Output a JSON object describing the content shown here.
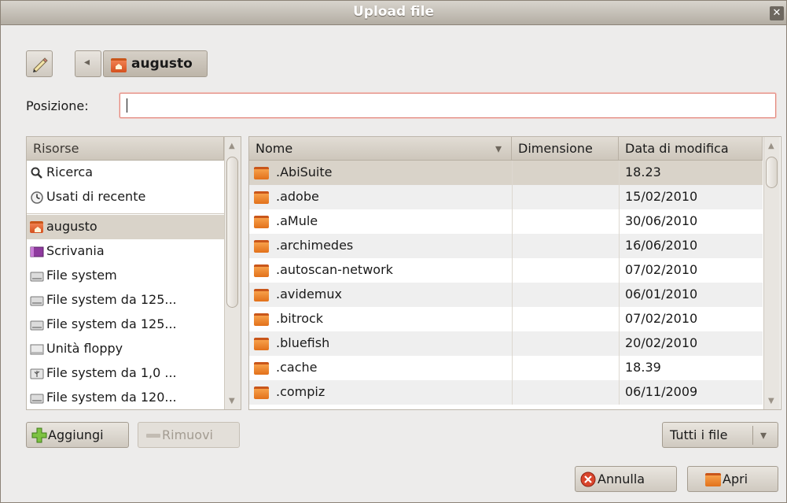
{
  "window": {
    "title": "Upload file",
    "close_glyph": "✕"
  },
  "toolbar": {
    "crumb_label": "augusto",
    "back_glyph": "◂"
  },
  "location": {
    "label": "Posizione:",
    "value": ""
  },
  "places": {
    "header": "Risorse",
    "items": [
      {
        "label": "Ricerca",
        "icon": "search-icon"
      },
      {
        "label": "Usati di recente",
        "icon": "recent-icon"
      },
      {
        "label": "augusto",
        "icon": "home-folder-icon"
      },
      {
        "label": "Scrivania",
        "icon": "desktop-icon"
      },
      {
        "label": "File system",
        "icon": "drive-icon"
      },
      {
        "label": "File system da 125...",
        "icon": "drive-icon"
      },
      {
        "label": "File system da 125...",
        "icon": "drive-icon"
      },
      {
        "label": "Unità floppy",
        "icon": "floppy-icon"
      },
      {
        "label": "File system da 1,0 ...",
        "icon": "usb-drive-icon"
      },
      {
        "label": "File system da 120...",
        "icon": "drive-icon"
      }
    ]
  },
  "files": {
    "columns": [
      "Nome",
      "Dimensione",
      "Data di modifica"
    ],
    "sort_glyph": "▾",
    "rows": [
      {
        "name": ".AbiSuite",
        "size": "",
        "date": "18.23"
      },
      {
        "name": ".adobe",
        "size": "",
        "date": "15/02/2010"
      },
      {
        "name": ".aMule",
        "size": "",
        "date": "30/06/2010"
      },
      {
        "name": ".archimedes",
        "size": "",
        "date": "16/06/2010"
      },
      {
        "name": ".autoscan-network",
        "size": "",
        "date": "07/02/2010"
      },
      {
        "name": ".avidemux",
        "size": "",
        "date": "06/01/2010"
      },
      {
        "name": ".bitrock",
        "size": "",
        "date": "07/02/2010"
      },
      {
        "name": ".bluefish",
        "size": "",
        "date": "20/02/2010"
      },
      {
        "name": ".cache",
        "size": "",
        "date": "18.39"
      },
      {
        "name": ".compiz",
        "size": "",
        "date": "06/11/2009"
      }
    ]
  },
  "buttons": {
    "add": "Aggiungi",
    "remove": "Rimuovi",
    "filter": "Tutti i file",
    "filter_arrow": "▾",
    "cancel": "Annulla",
    "open": "Apri"
  },
  "colors": {
    "selection": "#d9d3c9",
    "stripe": "#efefef",
    "accent": "#e2711b"
  }
}
